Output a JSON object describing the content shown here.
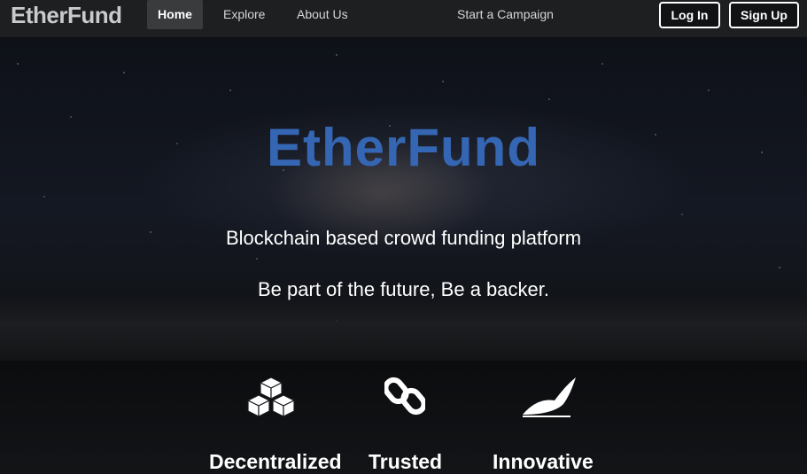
{
  "navbar": {
    "brand": "EtherFund",
    "links": [
      "Home",
      "Explore",
      "About Us",
      "Start a Campaign"
    ],
    "login": "Log In",
    "signup": "Sign Up"
  },
  "hero": {
    "title": "EtherFund",
    "subtitle": "Blockchain based crowd funding platform",
    "tagline": "Be part of the future, Be a backer."
  },
  "features": [
    {
      "label": "Decentralized",
      "icon": "blocks-icon"
    },
    {
      "label": "Trusted",
      "icon": "chain-link-icon"
    },
    {
      "label": "Innovative",
      "icon": "feather-icon"
    }
  ],
  "colors": {
    "brand_blue": "#3566b3",
    "navbar_bg": "#1e1f21",
    "active_tab_bg": "#3a3b3d"
  }
}
